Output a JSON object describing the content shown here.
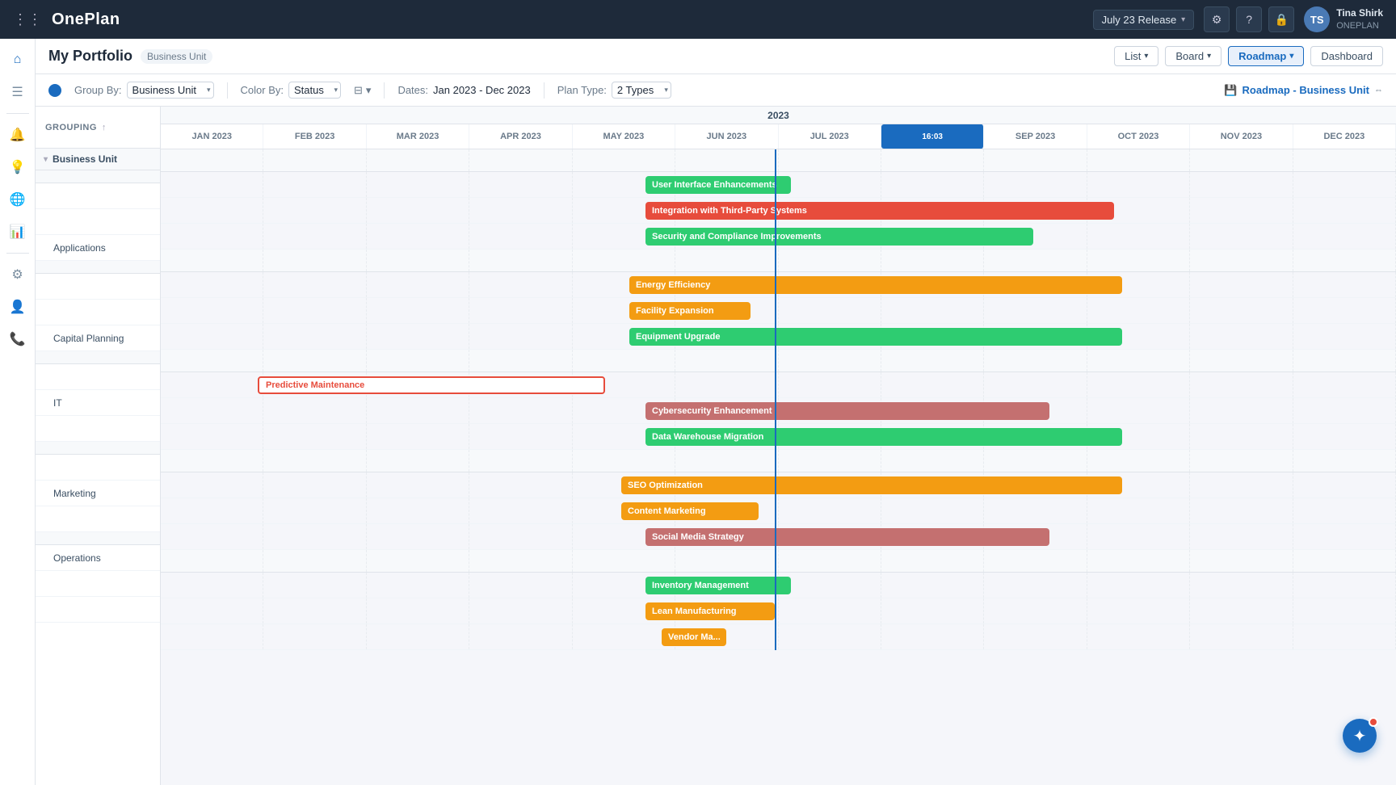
{
  "topbar": {
    "grid_icon": "⊞",
    "logo": "OnePlan",
    "release_label": "July 23 Release",
    "release_chevron": "▾",
    "settings_icon": "⚙",
    "help_icon": "?",
    "lock_icon": "🔒",
    "user": {
      "name": "Tina Shirk",
      "org": "ONEPLAN",
      "avatar_initials": "TS"
    }
  },
  "subheader": {
    "title": "My Portfolio",
    "subtitle": "Business Unit",
    "nav": {
      "list_label": "List",
      "board_label": "Board",
      "roadmap_label": "Roadmap",
      "dashboard_label": "Dashboard"
    }
  },
  "toolbar": {
    "group_by_label": "Group By:",
    "group_by_value": "Business Unit",
    "color_by_label": "Color By:",
    "color_by_value": "Status",
    "dates_label": "Dates:",
    "dates_value": "Jan 2023 - Dec 2023",
    "plan_type_label": "Plan Type:",
    "plan_type_value": "2 Types",
    "roadmap_business_unit": "Roadmap - Business Unit",
    "expand_icon": "⇔"
  },
  "grouping_header": "GROUPING",
  "business_unit_label": "Business Unit",
  "groups": [
    {
      "name": "Applications",
      "rows": [
        "Applications"
      ]
    },
    {
      "name": "Capital Planning",
      "rows": [
        "Capital Planning"
      ]
    },
    {
      "name": "IT",
      "rows": [
        "IT"
      ]
    },
    {
      "name": "Marketing",
      "rows": [
        "Marketing"
      ]
    },
    {
      "name": "Operations",
      "rows": [
        "Operations"
      ]
    }
  ],
  "months": [
    "JAN 2023",
    "FEB 2023",
    "MAR 2023",
    "APR 2023",
    "MAY 2023",
    "JUN 2023",
    "JUL 2023",
    "AUG 2023",
    "SEP 2023",
    "OCT 2023",
    "NOV 2023",
    "DEC 2023"
  ],
  "today_badge": "16:03",
  "today_month_index": 7,
  "year_label": "2023",
  "bars": {
    "applications": [
      {
        "label": "User Interface Enhancements",
        "color": "green",
        "start": 6.0,
        "end": 7.8
      },
      {
        "label": "Integration with Third-Party Systems",
        "color": "red",
        "start": 6.0,
        "end": 11.8
      },
      {
        "label": "Security and Compliance Improvements",
        "color": "green",
        "start": 6.0,
        "end": 10.8
      }
    ],
    "capital_planning": [
      {
        "label": "Energy Efficiency",
        "color": "yellow",
        "start": 5.8,
        "end": 11.9
      },
      {
        "label": "Facility Expansion",
        "color": "yellow",
        "start": 5.8,
        "end": 7.3
      },
      {
        "label": "Equipment Upgrade",
        "color": "green",
        "start": 5.8,
        "end": 11.9
      }
    ],
    "it": [
      {
        "label": "Predictive Maintenance",
        "color": "red",
        "start": 1.2,
        "end": 5.5
      },
      {
        "label": "Cybersecurity Enhancement",
        "color": "salmon",
        "start": 6.0,
        "end": 11.0
      },
      {
        "label": "Data Warehouse Migration",
        "color": "green",
        "start": 6.0,
        "end": 11.9
      }
    ],
    "marketing": [
      {
        "label": "SEO Optimization",
        "color": "yellow",
        "start": 5.7,
        "end": 11.9
      },
      {
        "label": "Content Marketing",
        "color": "yellow",
        "start": 5.7,
        "end": 7.4
      },
      {
        "label": "Social Media Strategy",
        "color": "salmon",
        "start": 6.0,
        "end": 11.0
      }
    ],
    "operations": [
      {
        "label": "Inventory Management",
        "color": "green",
        "start": 6.0,
        "end": 7.8
      },
      {
        "label": "Lean Manufacturing",
        "color": "yellow",
        "start": 6.0,
        "end": 7.6
      },
      {
        "label": "Vendor Ma...",
        "color": "yellow",
        "start": 6.2,
        "end": 7.0
      }
    ]
  },
  "sidebar_icons": [
    {
      "icon": "⌂",
      "name": "home-icon"
    },
    {
      "icon": "📋",
      "name": "list-icon"
    },
    {
      "icon": "🔔",
      "name": "notifications-icon"
    },
    {
      "icon": "💡",
      "name": "insights-icon"
    },
    {
      "icon": "🌐",
      "name": "globe-icon"
    },
    {
      "icon": "📊",
      "name": "reports-icon"
    },
    {
      "icon": "⚙",
      "name": "settings-icon"
    },
    {
      "icon": "👤",
      "name": "user-icon"
    },
    {
      "icon": "📞",
      "name": "phone-icon"
    }
  ],
  "colors": {
    "green": "#2ecc71",
    "red": "#e74c3c",
    "salmon": "#c0706e",
    "yellow": "#f39c12",
    "today_line": "#1a6bbf",
    "today_badge_bg": "#1a6bbf"
  }
}
